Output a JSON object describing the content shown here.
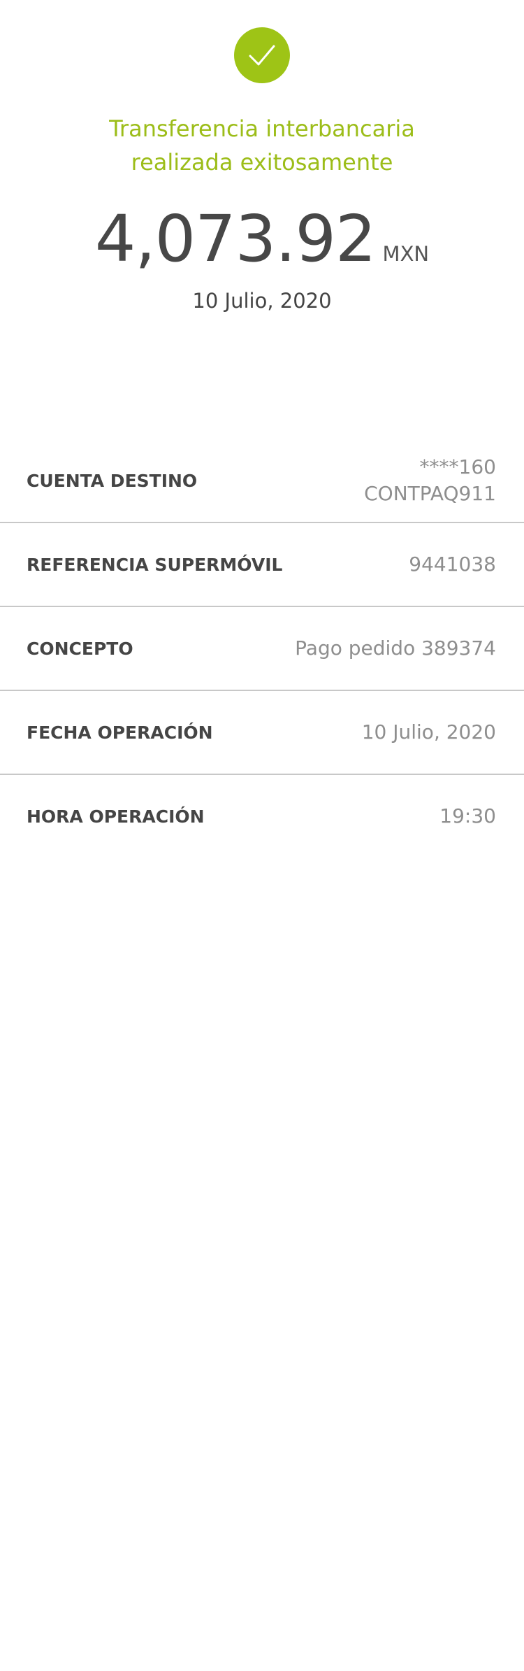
{
  "status": {
    "icon": "checkmark-icon",
    "color": "#9ec416",
    "title_line1": "Transferencia interbancaria",
    "title_line2": "realizada exitosamente"
  },
  "amount": {
    "value": "4,073.92",
    "currency": "MXN"
  },
  "date": "10 Julio, 2020",
  "details": [
    {
      "label": "CUENTA DESTINO",
      "value_line1": "****160",
      "value_line2": "CONTPAQ911"
    },
    {
      "label": "REFERENCIA SUPERMÓVIL",
      "value": "9441038"
    },
    {
      "label": "CONCEPTO",
      "value": "Pago pedido 389374"
    },
    {
      "label": "FECHA OPERACIÓN",
      "value": "10 Julio, 2020"
    },
    {
      "label": "HORA OPERACIÓN",
      "value": "19:30"
    }
  ]
}
